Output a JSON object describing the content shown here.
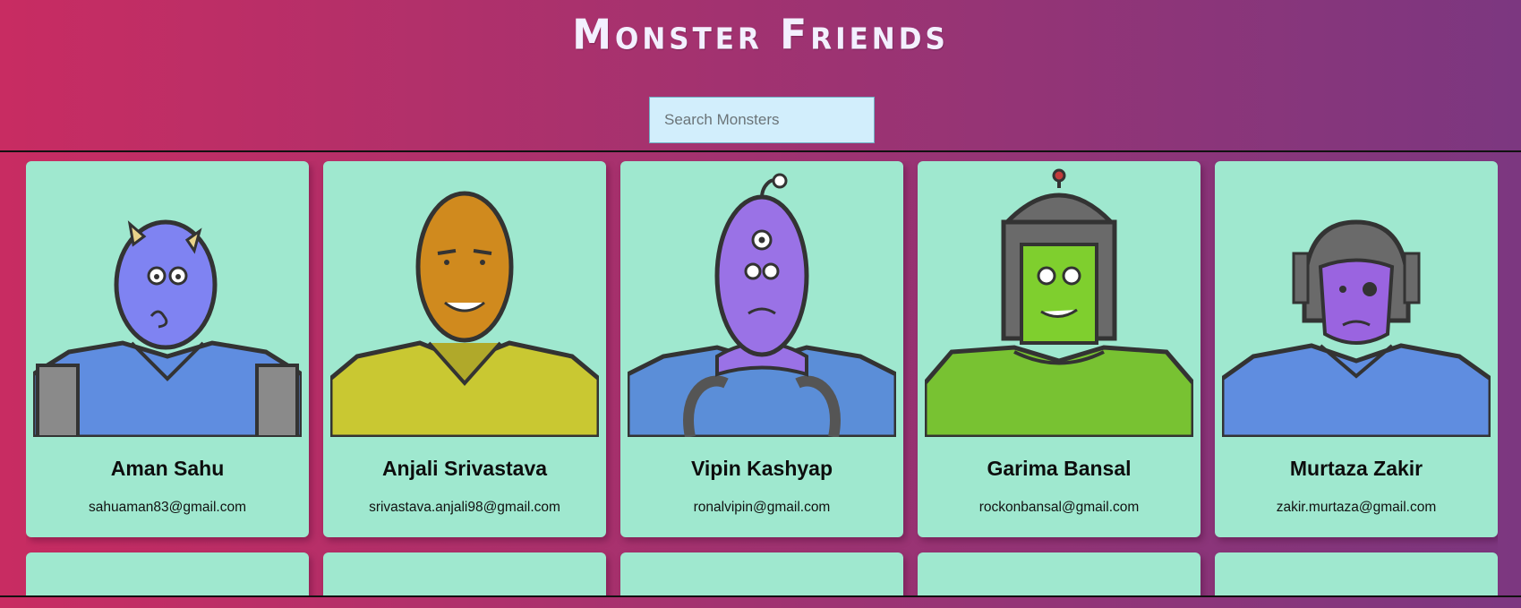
{
  "header": {
    "title": "Monster Friends"
  },
  "search": {
    "placeholder": "Search Monsters",
    "value": ""
  },
  "monsters": [
    {
      "name": "Aman Sahu",
      "email": "sahuaman83@gmail.com",
      "skin": "#7f83f2",
      "body": "#5f8de0"
    },
    {
      "name": "Anjali Srivastava",
      "email": "srivastava.anjali98@gmail.com",
      "skin": "#d08a1e",
      "body": "#c9c832"
    },
    {
      "name": "Vipin Kashyap",
      "email": "ronalvipin@gmail.com",
      "skin": "#9a72e6",
      "body": "#5b8ed8"
    },
    {
      "name": "Garima Bansal",
      "email": "rockonbansal@gmail.com",
      "skin": "#7fcf2e",
      "body": "#78c232"
    },
    {
      "name": "Murtaza Zakir",
      "email": "zakir.murtaza@gmail.com",
      "skin": "#9a64e0",
      "body": "#5f8de0"
    }
  ],
  "colors": {
    "card": "#9fe8cf",
    "search_bg": "#d2eefc",
    "gradient_left": "#c82c62",
    "gradient_right": "#7c3780"
  }
}
